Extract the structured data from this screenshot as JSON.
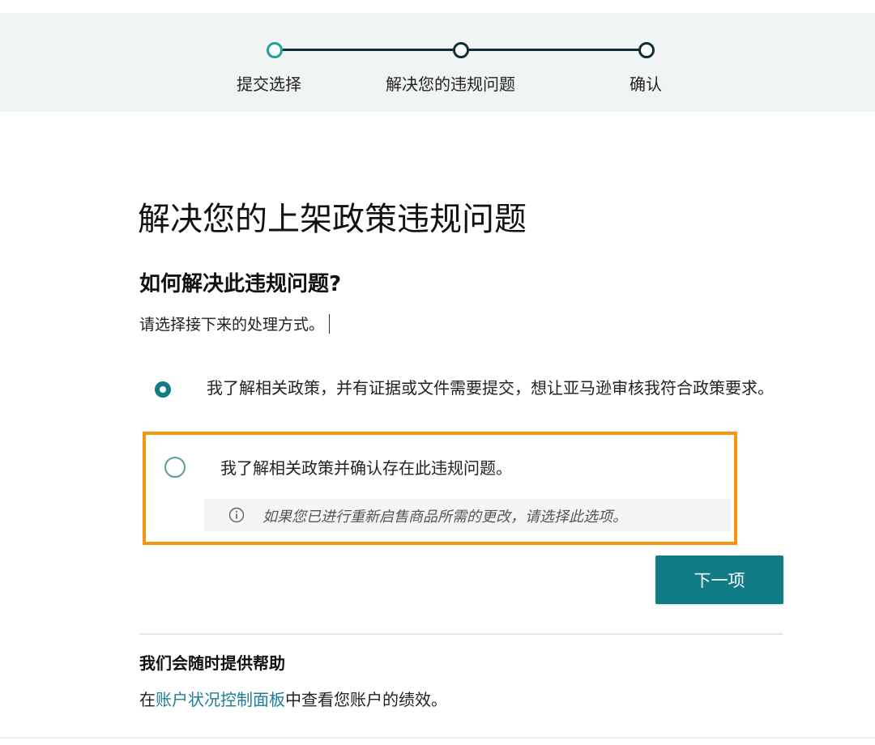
{
  "progress": {
    "steps": [
      {
        "label": "提交选择",
        "state": "current"
      },
      {
        "label": "解决您的违规问题",
        "state": "upcoming"
      },
      {
        "label": "确认",
        "state": "upcoming"
      }
    ]
  },
  "main": {
    "title": "解决您的上架政策违规问题",
    "question": "如何解决此违规问题?",
    "instruction": "请选择接下来的处理方式。",
    "options": [
      {
        "label": "我了解相关政策，并有证据或文件需要提交，想让亚马逊审核我符合政策要求。",
        "selected": true
      },
      {
        "label": "我了解相关政策并确认存在此违规问题。",
        "selected": false,
        "hint": "如果您已进行重新启售商品所需的更改，请选择此选项。",
        "hint_icon": "info-icon"
      }
    ],
    "next_label": "下一项"
  },
  "help": {
    "title": "我们会随时提供帮助",
    "text_prefix": "在",
    "link_label": "账户状况控制面板",
    "text_suffix": "中查看您账户的绩效。"
  },
  "colors": {
    "accent": "#117c86",
    "highlight": "#f5950c",
    "progress_active": "#24a09a",
    "link": "#1a7f97"
  }
}
